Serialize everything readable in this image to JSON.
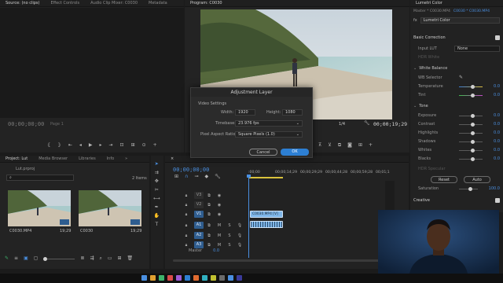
{
  "source_panel": {
    "tabs": [
      "Source: (no clips)",
      "Effect Controls",
      "Audio Clip Mixer: C0030",
      "Metadata"
    ],
    "timecode": "00;00;00;00",
    "page_label": "Page 1"
  },
  "program_panel": {
    "title": "Program: C0030",
    "timecode": "00;00;19;29",
    "zoom": "1/4"
  },
  "dialog": {
    "title": "Adjustment Layer",
    "section": "Video Settings",
    "width_label": "Width:",
    "width_value": "1920",
    "height_label": "Height:",
    "height_value": "1080",
    "timebase_label": "Timebase:",
    "timebase_value": "23.976 fps",
    "par_label": "Pixel Aspect Ratio:",
    "par_value": "Square Pixels (1.0)",
    "cancel_label": "Cancel",
    "ok_label": "OK"
  },
  "project_panel": {
    "tabs": [
      "Project: Lut",
      "Media Browser",
      "Libraries",
      "Info"
    ],
    "file_name": "Lut.prproj",
    "item_count": "2 Items",
    "clips": [
      {
        "name": "C0030.MP4",
        "duration": "19;29"
      },
      {
        "name": "C0030",
        "duration": "19;29"
      }
    ]
  },
  "timeline": {
    "timecode": "00;00;00;00",
    "ruler": [
      ":00;00",
      "00;00;14;29",
      "00;00;29;29",
      "00;00;44;28",
      "00;00;59;28",
      "00;01;1"
    ],
    "video_tracks": [
      "V3",
      "V2",
      "V1"
    ],
    "audio_tracks": [
      "A1",
      "A2",
      "A3"
    ],
    "video_clip_label": "C0030.MP4 [V]",
    "master_label": "Master",
    "master_value": "0.0"
  },
  "lumetri": {
    "panel_title": "Lumetri Color",
    "breadcrumb_left": "Master * C0030.MP4",
    "breadcrumb_right": "C0030 * C0030.MP4",
    "effect_name": "Lumetri Color",
    "section_basic": "Basic Correction",
    "input_lut_label": "Input LUT",
    "input_lut_value": "None",
    "hdr_white_label": "HDR White",
    "white_balance_label": "White Balance",
    "wb_selector_label": "WB Selector",
    "temperature_label": "Temperature",
    "temperature_value": "0.0",
    "tint_label": "Tint",
    "tint_value": "0.0",
    "tone_label": "Tone",
    "tone_rows": [
      {
        "label": "Exposure",
        "value": "0.0"
      },
      {
        "label": "Contrast",
        "value": "0.0"
      },
      {
        "label": "Highlights",
        "value": "0.0"
      },
      {
        "label": "Shadows",
        "value": "0.0"
      },
      {
        "label": "Whites",
        "value": "0.0"
      },
      {
        "label": "Blacks",
        "value": "0.0"
      }
    ],
    "hdr_specular_label": "HDR Specular",
    "reset_label": "Reset",
    "auto_label": "Auto",
    "saturation_label": "Saturation",
    "saturation_value": "100.0",
    "creative_label": "Creative"
  },
  "colors": {
    "accent": "#4a8fe0",
    "ok_button": "#2d7fd3",
    "clip_blue": "#7fb6e8"
  }
}
